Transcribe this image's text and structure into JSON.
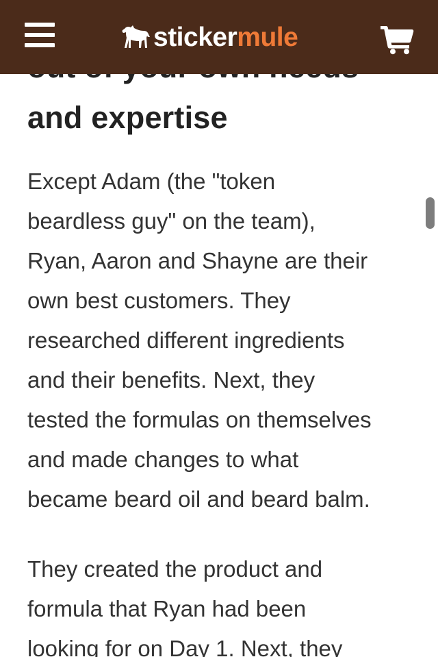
{
  "nav": {
    "menu_icon": "hamburger-menu-icon",
    "logo_icon": "mule-icon",
    "logo_word_1": "sticker",
    "logo_word_2": "mule",
    "logo_color_1": "#ffffff",
    "logo_color_2": "#ef7a37",
    "cart_icon": "shopping-cart-icon",
    "background": "#4b2b1a"
  },
  "article": {
    "heading_cut_line": "out of your own needs",
    "heading_line_2": "and expertise",
    "paragraph_1": [
      "Except Adam (the \"token",
      "beardless guy\" on the team),",
      "Ryan, Aaron and Shayne are their",
      "own best customers. They",
      "researched different ingredients",
      "and their benefits. Next, they",
      "tested the formulas on themselves",
      "and made changes to what",
      "became beard oil and beard balm."
    ],
    "paragraph_2": [
      "They created the product and",
      "formula that Ryan had been",
      "looking for on Day 1. Next, they"
    ]
  }
}
